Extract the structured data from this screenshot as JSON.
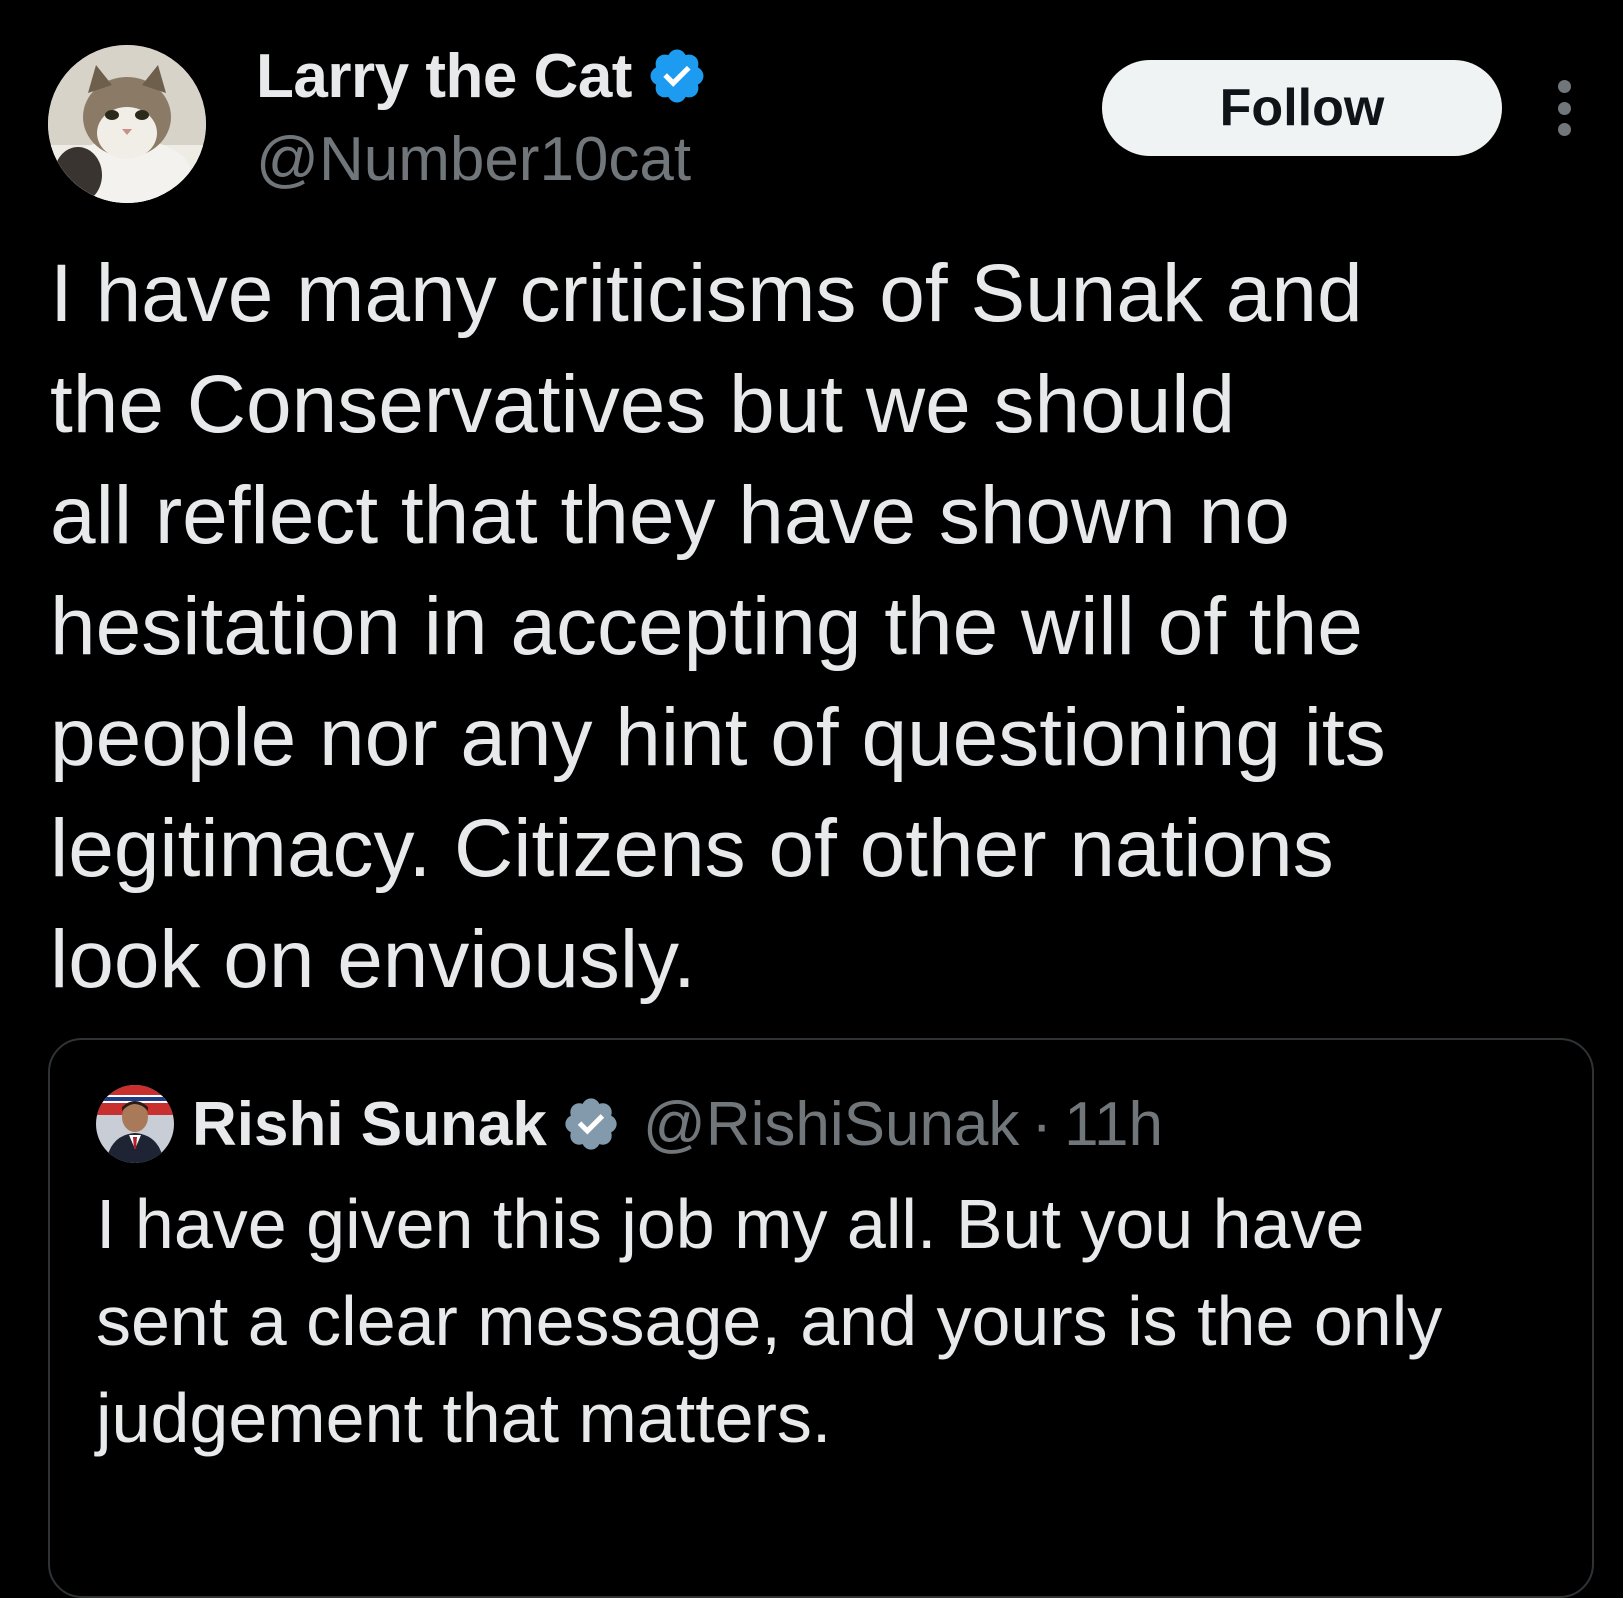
{
  "author": {
    "display_name": "Larry the Cat",
    "handle": "@Number10cat",
    "verified_icon": "verified-badge-icon",
    "verified_color": "#1d9bf0",
    "avatar": "cat-avatar"
  },
  "actions": {
    "follow_label": "Follow",
    "more_icon": "more-vertical-icon"
  },
  "tweet": {
    "text_lines": [
      "I have many criticisms of Sunak and",
      "the Conservatives but we should",
      "all reflect that they have shown no",
      "hesitation in accepting the will of the",
      "people nor any hint of questioning its",
      "legitimacy. Citizens of other nations",
      "look on enviously."
    ]
  },
  "quoted_tweet": {
    "display_name": "Rishi Sunak",
    "handle": "@RishiSunak",
    "separator": "·",
    "time": "11h",
    "verified_icon": "verified-badge-grey-icon",
    "verified_color": "#829aab",
    "avatar": "person-avatar",
    "text_lines": [
      "I have given this job my all. But you have",
      "sent a clear message, and yours is the only",
      "judgement that matters."
    ]
  }
}
